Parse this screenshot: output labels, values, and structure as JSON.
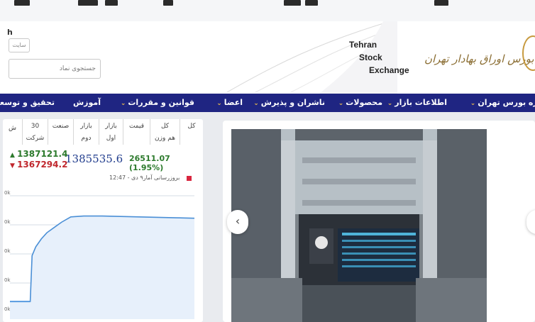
{
  "header": {
    "lang_button": "h",
    "site_placeholder": "سایت",
    "search_placeholder": "جستجوی نماد",
    "brand_en": [
      "Tehran",
      "Stock",
      "Exchange"
    ],
    "brand_fa": "بورس اوراق بهادار تهران",
    "brand_color": "#8a6d32"
  },
  "nav": {
    "background": "#1f2582",
    "items": [
      {
        "label": "درباره بورس تهران",
        "chevron": true
      },
      {
        "label": "اطلاعات بازار",
        "chevron": true
      },
      {
        "label": "محصولات",
        "chevron": true
      },
      {
        "label": "ناشران و پذیرش",
        "chevron": true
      },
      {
        "label": "اعضا",
        "chevron": true
      },
      {
        "label": "قوانین و مقررات",
        "chevron": true
      },
      {
        "label": "آموزش",
        "chevron": false
      },
      {
        "label": "تحقیق و توسعه",
        "chevron": false
      }
    ]
  },
  "market_panel": {
    "tabs": [
      {
        "line1": "کل",
        "line2": ""
      },
      {
        "line1": "کل",
        "line2": "هم وزن"
      },
      {
        "line1": "قیمت",
        "line2": ""
      },
      {
        "line1": "بازار",
        "line2": "اول"
      },
      {
        "line1": "بازار",
        "line2": "دوم"
      },
      {
        "line1": "صنعت",
        "line2": ""
      },
      {
        "line1": "30",
        "line2": "شرکت"
      },
      {
        "line1": "",
        "line2": "ش"
      }
    ],
    "high": "1387121.4",
    "low": "1367294.2",
    "index_value": "1385535.6",
    "change": "26511.07 (1.95%)",
    "update_text": "بروزرسانی آمار۹ دی - 12:47",
    "status_color": "#d9263f",
    "positive_color": "#2c7a2c",
    "negative_color": "#c0272d",
    "index_color": "#1f3b8c"
  },
  "chart_data": {
    "type": "area",
    "series": [
      {
        "x": [
          0,
          6,
          11,
          12,
          14,
          17,
          20,
          24,
          28,
          33,
          40,
          50,
          60,
          70,
          80,
          90,
          100
        ],
        "values": [
          0,
          0,
          0,
          52,
          62,
          71,
          78,
          84,
          90,
          96,
          97,
          97,
          96.5,
          96,
          95.5,
          95,
          94.5
        ]
      }
    ],
    "xlim": [
      0,
      100
    ],
    "ylim": [
      -20,
      128
    ],
    "ytick_labels": [
      "0k",
      "0k",
      "0k",
      "0k",
      "0k"
    ],
    "grid": "horizontal",
    "line_color": "#4a8fd6",
    "fill_color": "#e7f0fb",
    "baseline_color": "#5a9ce0"
  },
  "carousel": {
    "prev_label": "‹",
    "next_label": "›"
  }
}
